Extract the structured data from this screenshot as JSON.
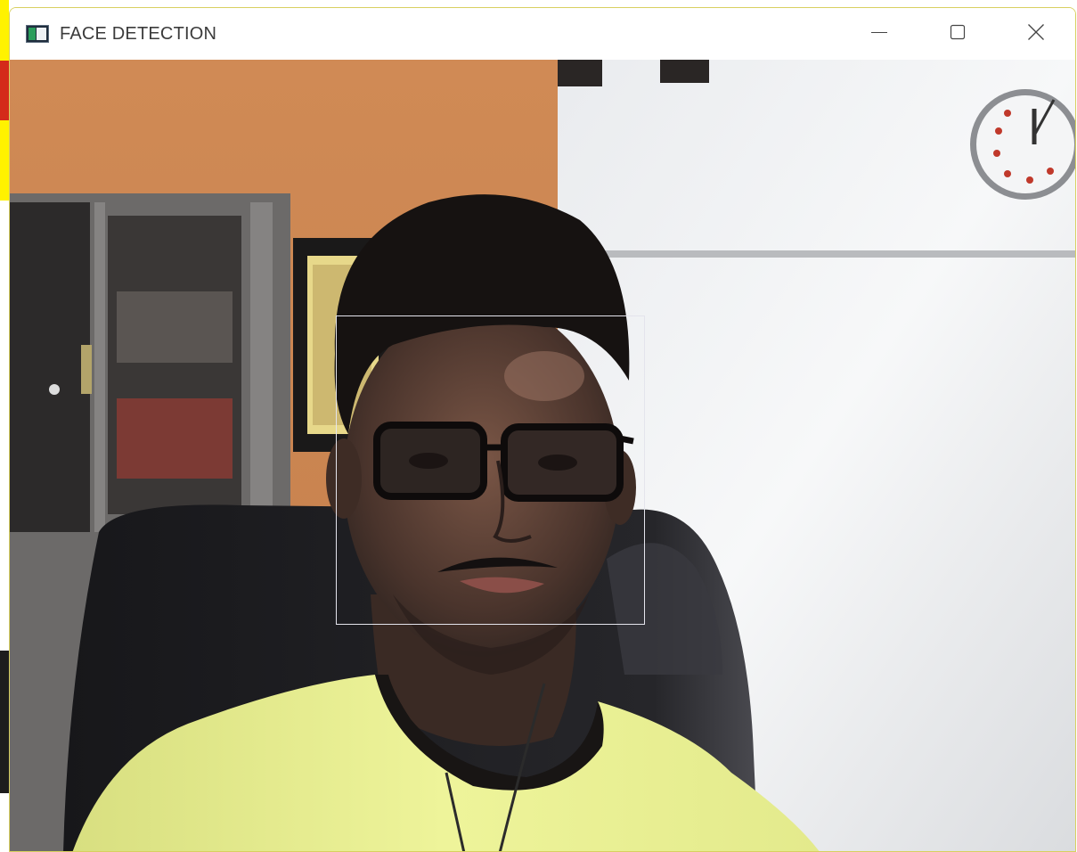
{
  "window": {
    "title": "FACE DETECTION",
    "controls": {
      "minimize": "minimize-icon",
      "maximize": "maximize-icon",
      "close": "close-icon"
    }
  },
  "camera_feed": {
    "detections": [
      {
        "label": "face"
      }
    ],
    "box_color": "#e4e4ec"
  },
  "colors": {
    "wall_orange": "#d9915a",
    "wall_white": "#eef0f2",
    "shirt": "#e8f08e",
    "chair": "#1c1c1f"
  }
}
